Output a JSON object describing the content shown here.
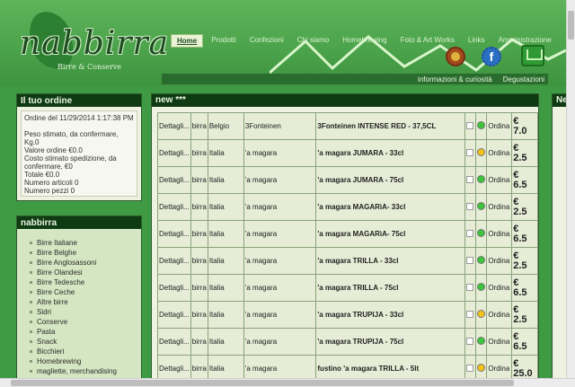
{
  "header": {
    "logo_text": "nabbirra",
    "logo_subtitle": "Birre & Conserve",
    "nav": [
      "Home",
      "Prodotti",
      "Confezioni",
      "Chi siamo",
      "Homebrewing",
      "Foto & Art Works",
      "Links",
      "Amministrazione"
    ],
    "subnav": [
      "informazioni & curiosità",
      "Degustazioni"
    ]
  },
  "order": {
    "title": "Il tuo ordine",
    "lines": [
      "Ordine del 11/29/2014 1:17:38 PM",
      "",
      "Peso stimato, da confermare, Kg.0",
      "Valore ordine €0.0",
      "Costo stimato spedizione, da",
      "confermare, €0",
      "Totale €0.0",
      "Numero articoli 0",
      "Numero pezzi 0"
    ]
  },
  "categories": {
    "title": "nabbirra",
    "items": [
      "Birre Italiane",
      "Birre Belghe",
      "Birre Anglosassoni",
      "Birre Olandesi",
      "Birre Tedesche",
      "Birre Ceche",
      "Altre birre",
      "Sidri",
      "Conserve",
      "Pasta",
      "Snack",
      "Bicchieri",
      "Homebrewing",
      "magliette, merchandising"
    ]
  },
  "main": {
    "title": "new ***",
    "rows": [
      {
        "details": "Dettagli...",
        "type": "birra",
        "country": "Belgio",
        "brand": "3Fonteinen",
        "name": "3Fonteinen INTENSE RED - 37,5CL",
        "status": "green",
        "order": "Ordina",
        "currency": "€",
        "price": "7.0"
      },
      {
        "details": "Dettagli...",
        "type": "birra",
        "country": "Italia",
        "brand": "'a magara",
        "name": "'a magara JUMARA - 33cl",
        "status": "yellow",
        "order": "Ordina",
        "currency": "€",
        "price": "2.5"
      },
      {
        "details": "Dettagli...",
        "type": "birra",
        "country": "Italia",
        "brand": "'a magara",
        "name": "'a magara JUMARA - 75cl",
        "status": "green",
        "order": "Ordina",
        "currency": "€",
        "price": "6.5"
      },
      {
        "details": "Dettagli...",
        "type": "birra",
        "country": "Italia",
        "brand": "'a magara",
        "name": "'a magara MAGARìA- 33cl",
        "status": "green",
        "order": "Ordina",
        "currency": "€",
        "price": "2.5"
      },
      {
        "details": "Dettagli...",
        "type": "birra",
        "country": "Italia",
        "brand": "'a magara",
        "name": "'a magara MAGARìA- 75cl",
        "status": "green",
        "order": "Ordina",
        "currency": "€",
        "price": "6.5"
      },
      {
        "details": "Dettagli...",
        "type": "birra",
        "country": "Italia",
        "brand": "'a magara",
        "name": "'a magara TRILLA - 33cl",
        "status": "green",
        "order": "Ordina",
        "currency": "€",
        "price": "2.5"
      },
      {
        "details": "Dettagli...",
        "type": "birra",
        "country": "Italia",
        "brand": "'a magara",
        "name": "'a magara TRILLA - 75cl",
        "status": "green",
        "order": "Ordina",
        "currency": "€",
        "price": "6.5"
      },
      {
        "details": "Dettagli...",
        "type": "birra",
        "country": "Italia",
        "brand": "'a magara",
        "name": "'a magara TRUPIJA - 33cl",
        "status": "yellow",
        "order": "Ordina",
        "currency": "€",
        "price": "2.5"
      },
      {
        "details": "Dettagli...",
        "type": "birra",
        "country": "Italia",
        "brand": "'a magara",
        "name": "'a magara TRUPIJA - 75cl",
        "status": "green",
        "order": "Ordina",
        "currency": "€",
        "price": "6.5"
      },
      {
        "details": "Dettagli...",
        "type": "birra",
        "country": "Italia",
        "brand": "'a magara",
        "name": "fustino 'a magara TRILLA - 5lt",
        "status": "yellow",
        "order": "Ordina",
        "currency": "€",
        "price": "25.0"
      }
    ]
  },
  "right_col": {
    "title": "Ne"
  },
  "colors": {
    "green_dot": "#3cc43a",
    "yellow_dot": "#f2c21b",
    "dark_title": "#0f3b12"
  }
}
